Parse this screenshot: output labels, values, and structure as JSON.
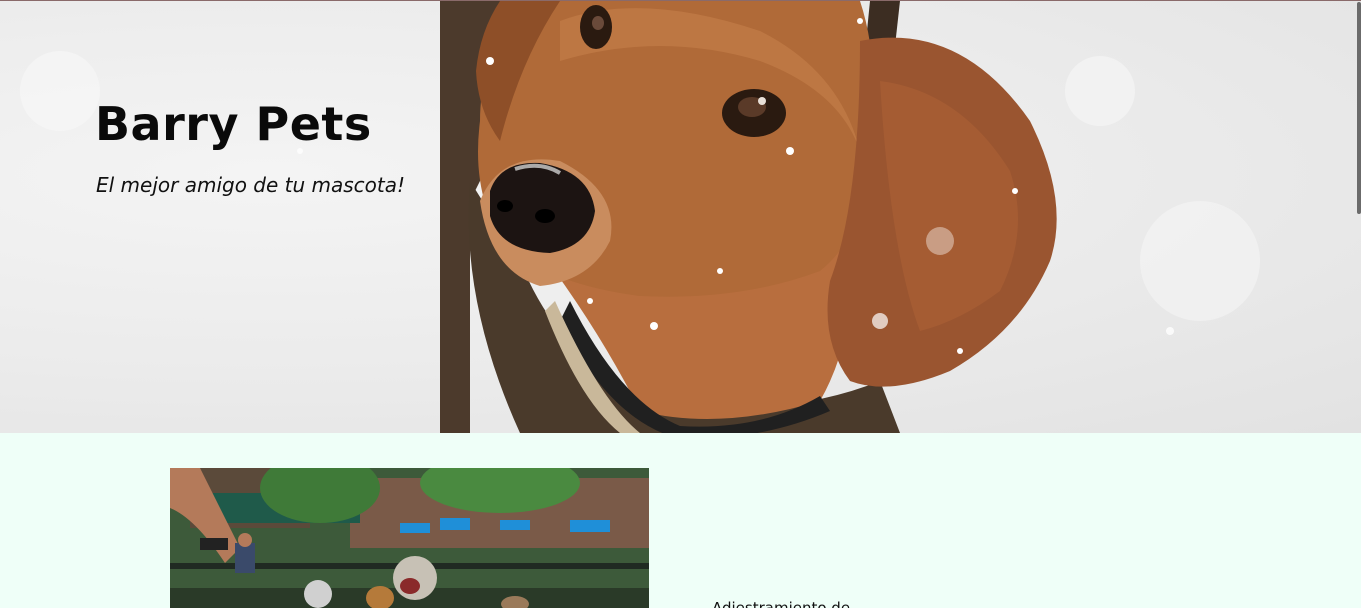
{
  "hero": {
    "title": "Barry Pets",
    "subtitle": "El mejor amigo de tu mascota!",
    "image_subject": "dachshund-in-snow"
  },
  "content": {
    "image_subject": "dogs-in-park",
    "text": "Adiestramiento de"
  },
  "colors": {
    "section_background": "#effff8",
    "hero_background": "#ebebeb",
    "text": "#0a0a0a"
  }
}
